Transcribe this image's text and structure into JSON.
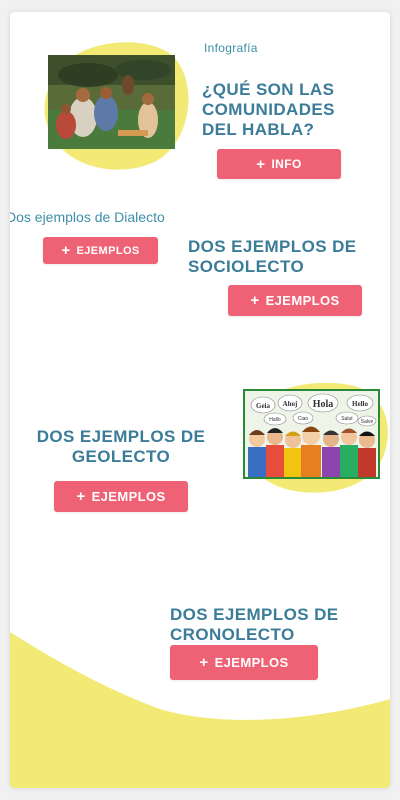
{
  "colors": {
    "accent_button": "#ef6275",
    "heading": "#3b7c98",
    "eyebrow": "#3d8fa9",
    "blob_yellow": "#f2ea74",
    "image2_border": "#2a8a3a"
  },
  "header": {
    "eyebrow": "Infografía",
    "title": "¿QUÉ SON LAS COMUNIDADES DEL HABLA?",
    "info_button": "INFO"
  },
  "dialecto": {
    "label": "Dos ejemplos de Dialecto",
    "button": "EJEMPLOS"
  },
  "sociolecto": {
    "title": "DOS EJEMPLOS DE SOCIOLECTO",
    "button": "EJEMPLOS"
  },
  "geolecto": {
    "title": "DOS EJEMPLOS DE GEOLECTO",
    "button": "EJEMPLOS"
  },
  "cronolecto": {
    "title": "DOS EJEMPLOS DE CRONOLECTO",
    "button": "EJEMPLOS"
  },
  "speech_bubbles": [
    "Geia",
    "Ahoj",
    "Hola",
    "Hello",
    "Hallo",
    "Ciao",
    "Salut",
    "Salve"
  ]
}
